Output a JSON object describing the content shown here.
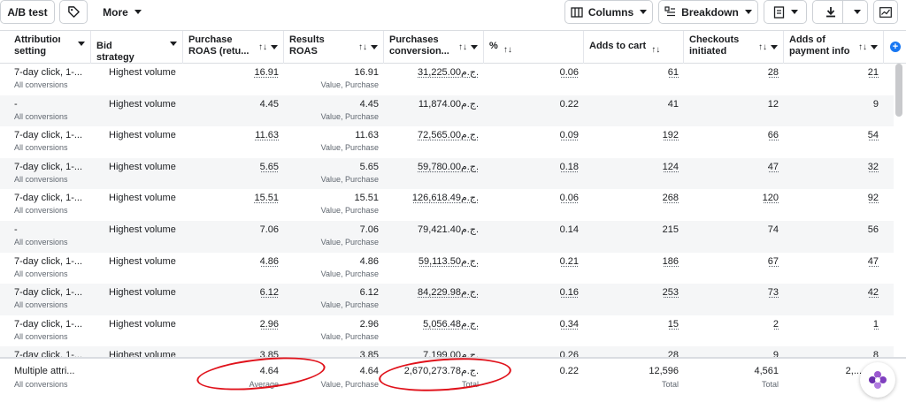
{
  "toolbar": {
    "ab_test": "A/B test",
    "more": "More",
    "columns": "Columns",
    "breakdown": "Breakdown"
  },
  "headers": [
    {
      "label": "Attribution setting"
    },
    {
      "label": "Bid strategy"
    },
    {
      "label": "Purchase ROAS (retu..."
    },
    {
      "label": "Results ROAS"
    },
    {
      "label": "Purchases conversion..."
    },
    {
      "label": "%"
    },
    {
      "label": "Adds to cart"
    },
    {
      "label": "Checkouts initiated"
    },
    {
      "label": "Adds of payment info"
    }
  ],
  "rows": [
    {
      "attribution": "7-day click, 1-...",
      "attr_sub": "All conversions",
      "bid": "Highest volume",
      "purchase_roas": "16.91",
      "results_roas": "16.91",
      "results_sub": "Value, Purchase",
      "conv_value": "31,225.00ج.م.",
      "pct": "0.06",
      "adds_to_cart": "61",
      "checkouts": "28",
      "payment_info": "21",
      "linked": true
    },
    {
      "attribution": "-",
      "attr_sub": "All conversions",
      "bid": "Highest volume",
      "purchase_roas": "4.45",
      "results_roas": "4.45",
      "results_sub": "Value, Purchase",
      "conv_value": "11,874.00ج.م.",
      "pct": "0.22",
      "adds_to_cart": "41",
      "checkouts": "12",
      "payment_info": "9",
      "linked": false
    },
    {
      "attribution": "7-day click, 1-...",
      "attr_sub": "All conversions",
      "bid": "Highest volume",
      "purchase_roas": "11.63",
      "results_roas": "11.63",
      "results_sub": "Value, Purchase",
      "conv_value": "72,565.00ج.م.",
      "pct": "0.09",
      "adds_to_cart": "192",
      "checkouts": "66",
      "payment_info": "54",
      "linked": true
    },
    {
      "attribution": "7-day click, 1-...",
      "attr_sub": "All conversions",
      "bid": "Highest volume",
      "purchase_roas": "5.65",
      "results_roas": "5.65",
      "results_sub": "Value, Purchase",
      "conv_value": "59,780.00ج.م.",
      "pct": "0.18",
      "adds_to_cart": "124",
      "checkouts": "47",
      "payment_info": "32",
      "linked": true
    },
    {
      "attribution": "7-day click, 1-...",
      "attr_sub": "All conversions",
      "bid": "Highest volume",
      "purchase_roas": "15.51",
      "results_roas": "15.51",
      "results_sub": "Value, Purchase",
      "conv_value": "126,618.49ج.م.",
      "pct": "0.06",
      "adds_to_cart": "268",
      "checkouts": "120",
      "payment_info": "92",
      "linked": true
    },
    {
      "attribution": "-",
      "attr_sub": "All conversions",
      "bid": "Highest volume",
      "purchase_roas": "7.06",
      "results_roas": "7.06",
      "results_sub": "Value, Purchase",
      "conv_value": "79,421.40ج.م.",
      "pct": "0.14",
      "adds_to_cart": "215",
      "checkouts": "74",
      "payment_info": "56",
      "linked": false
    },
    {
      "attribution": "7-day click, 1-...",
      "attr_sub": "All conversions",
      "bid": "Highest volume",
      "purchase_roas": "4.86",
      "results_roas": "4.86",
      "results_sub": "Value, Purchase",
      "conv_value": "59,113.50ج.م.",
      "pct": "0.21",
      "adds_to_cart": "186",
      "checkouts": "67",
      "payment_info": "47",
      "linked": true
    },
    {
      "attribution": "7-day click, 1-...",
      "attr_sub": "All conversions",
      "bid": "Highest volume",
      "purchase_roas": "6.12",
      "results_roas": "6.12",
      "results_sub": "Value, Purchase",
      "conv_value": "84,229.98ج.م.",
      "pct": "0.16",
      "adds_to_cart": "253",
      "checkouts": "73",
      "payment_info": "42",
      "linked": true
    },
    {
      "attribution": "7-day click, 1-...",
      "attr_sub": "All conversions",
      "bid": "Highest volume",
      "purchase_roas": "2.96",
      "results_roas": "2.96",
      "results_sub": "Value, Purchase",
      "conv_value": "5,056.48ج.م.",
      "pct": "0.34",
      "adds_to_cart": "15",
      "checkouts": "2",
      "payment_info": "1",
      "linked": true
    },
    {
      "attribution": "7-day click, 1-...",
      "attr_sub": "All conversions",
      "bid": "Highest volume",
      "purchase_roas": "3.85",
      "results_roas": "3.85",
      "results_sub": "Value, Purchase",
      "conv_value": "7,199.00ج.م.",
      "pct": "0.26",
      "adds_to_cart": "28",
      "checkouts": "9",
      "payment_info": "8",
      "linked": true
    }
  ],
  "footer": {
    "attribution": "Multiple attri...",
    "attr_sub": "All conversions",
    "purchase_roas": "4.64",
    "purchase_roas_sub": "Average",
    "results_roas": "4.64",
    "results_sub": "Value, Purchase",
    "conv_value": "2,670,273.78ج.م.",
    "conv_sub": "Total",
    "pct": "0.22",
    "adds_to_cart": "12,596",
    "adds_sub": "Total",
    "checkouts": "4,561",
    "checkouts_sub": "Total",
    "payment_info": "2,..."
  },
  "colors": {
    "highlight": "#e0121b",
    "accent": "#1877f2",
    "alt_row": "#f5f6f7"
  }
}
